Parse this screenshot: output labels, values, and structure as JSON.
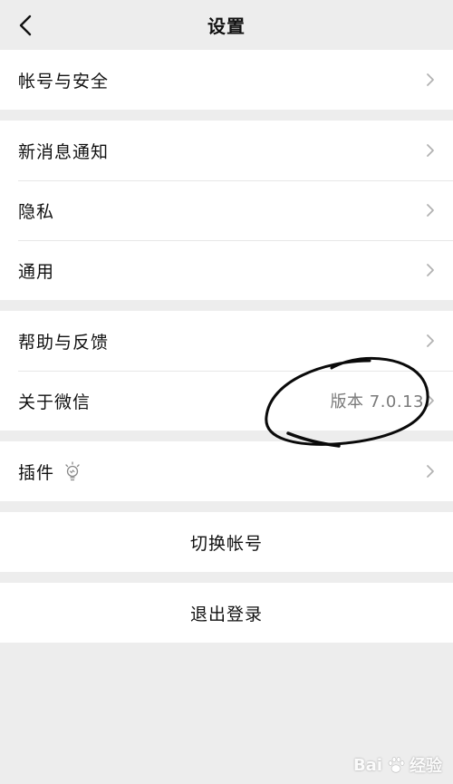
{
  "header": {
    "title": "设置"
  },
  "groups": [
    {
      "items": [
        {
          "label": "帐号与安全"
        }
      ]
    },
    {
      "items": [
        {
          "label": "新消息通知"
        },
        {
          "label": "隐私"
        },
        {
          "label": "通用"
        }
      ]
    },
    {
      "items": [
        {
          "label": "帮助与反馈"
        },
        {
          "label": "关于微信",
          "value": "版本 7.0.13"
        }
      ]
    },
    {
      "items": [
        {
          "label": "插件"
        }
      ]
    }
  ],
  "actions": {
    "switch_account": "切换帐号",
    "logout": "退出登录"
  },
  "watermark": {
    "left": "Bai",
    "right": "经验"
  },
  "icons": {
    "back": "chevron-left-icon",
    "chevron": "chevron-right-icon",
    "plugin": "lightbulb-icon",
    "annotation": "hand-drawn-circle"
  },
  "colors": {
    "background": "#ededed",
    "card": "#ffffff",
    "secondary_text": "#7a7a7a",
    "chevron": "#b2b2b2"
  }
}
